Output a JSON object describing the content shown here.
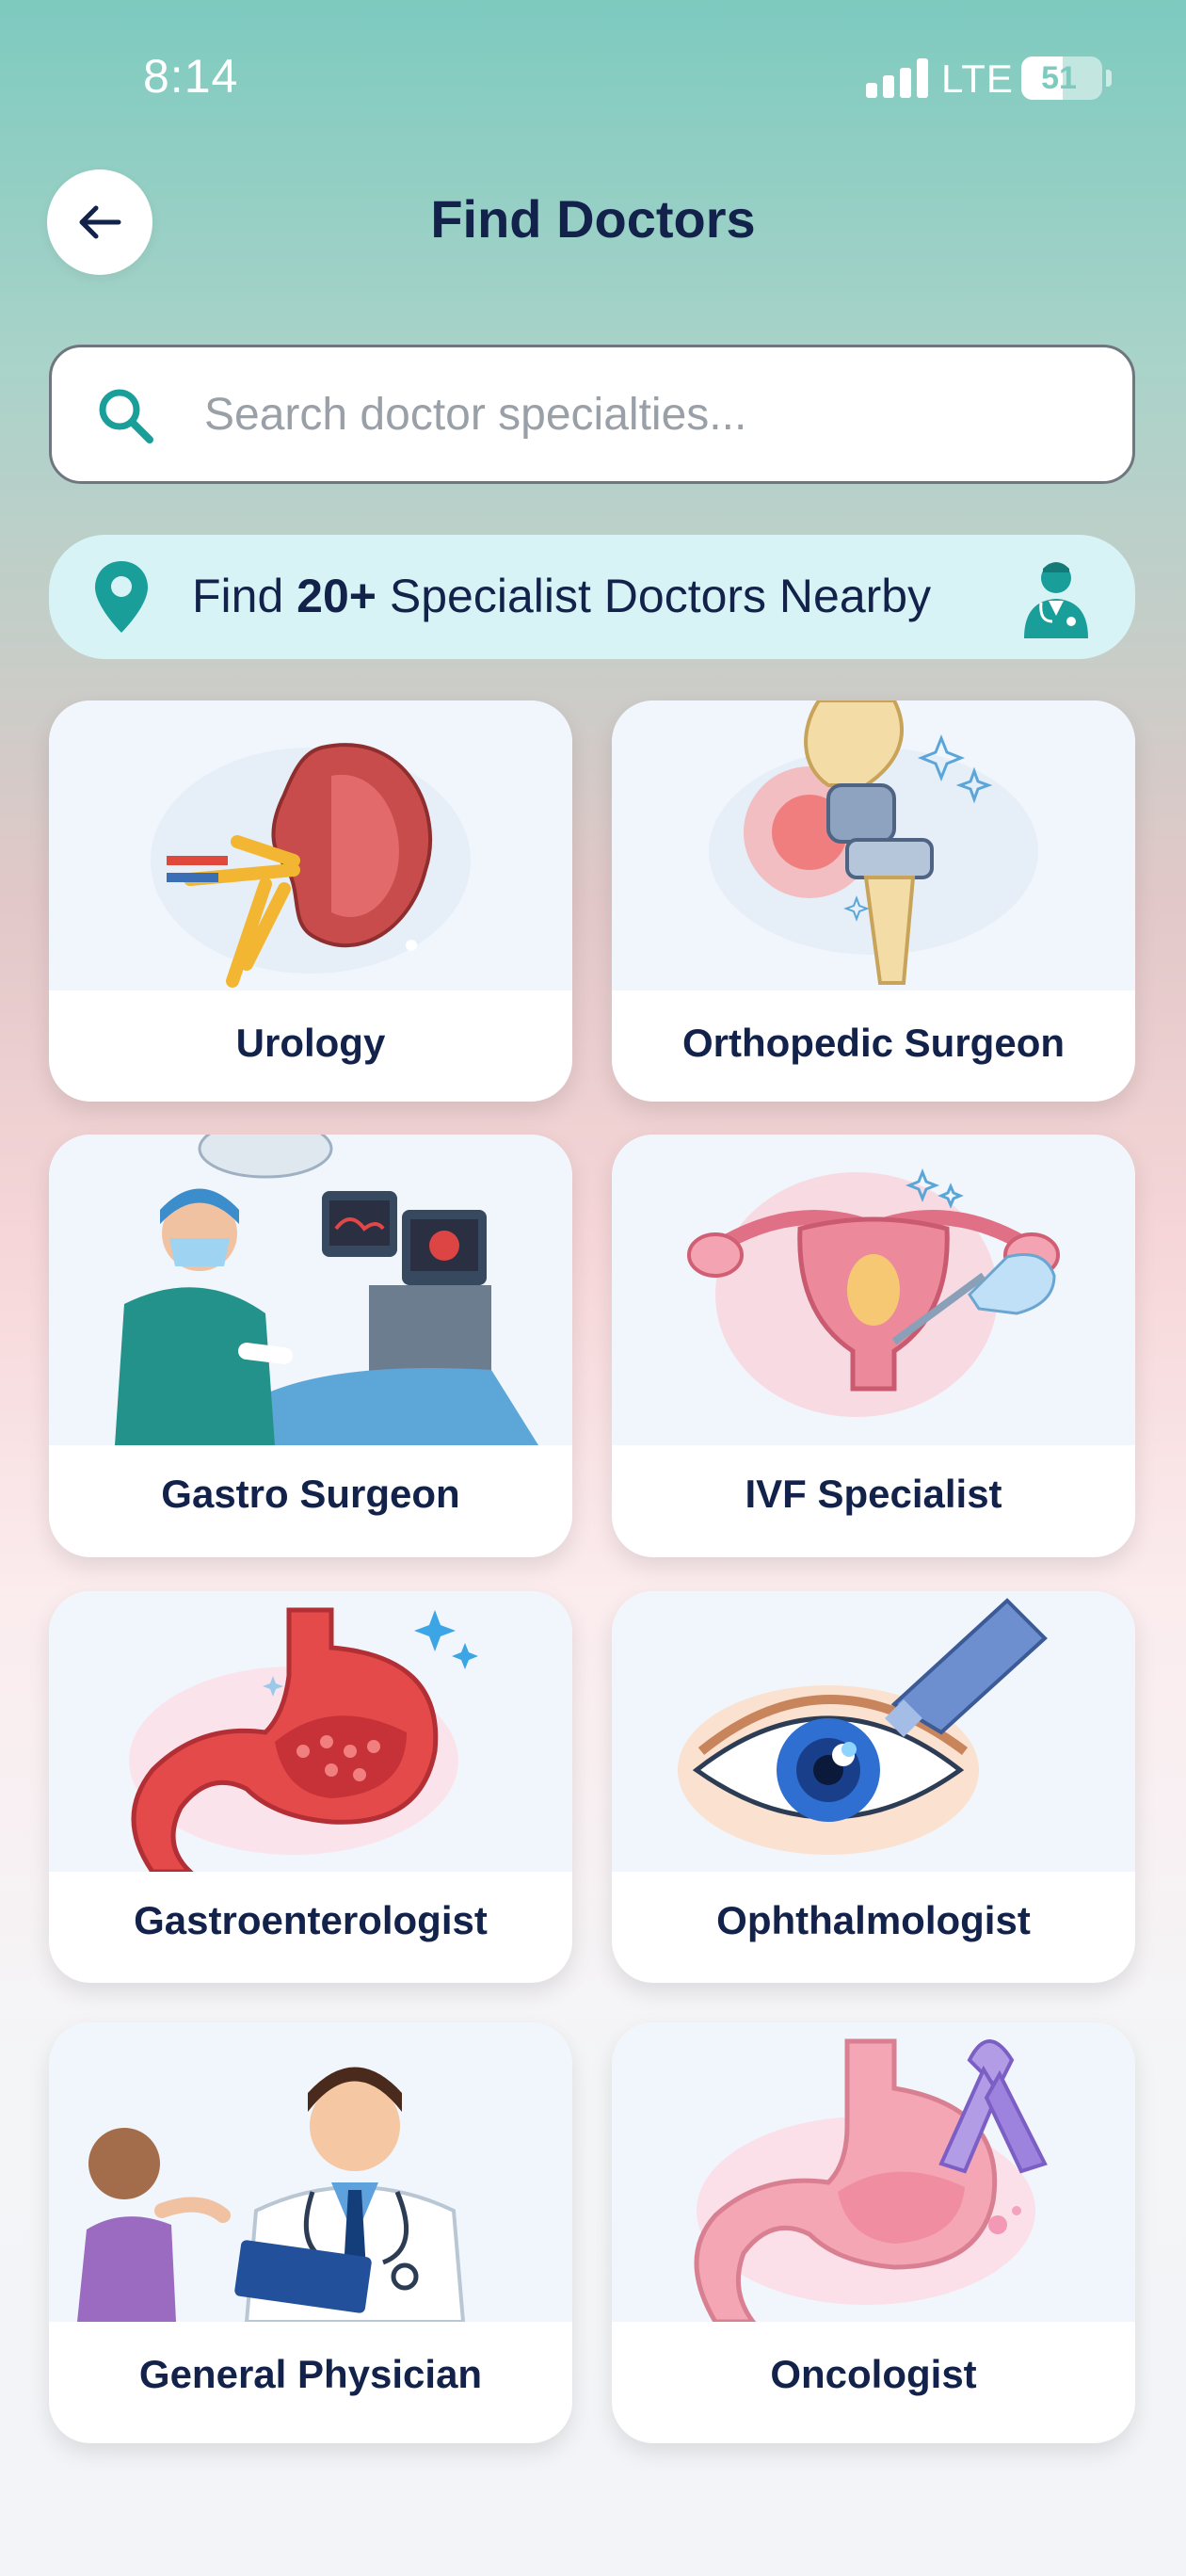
{
  "status_bar": {
    "time": "8:14",
    "network": "LTE",
    "battery": "51",
    "battery_level": 0.51
  },
  "header": {
    "title": "Find Doctors",
    "back_icon": "arrow-left-icon"
  },
  "search": {
    "placeholder": "Search doctor specialties...",
    "value": "",
    "icon": "search-icon"
  },
  "banner": {
    "prefix": "Find ",
    "count": "20+",
    "suffix": " Specialist Doctors Nearby",
    "left_icon": "map-pin-icon",
    "right_icon": "doctor-icon"
  },
  "specialties": [
    {
      "label": "Urology",
      "icon": "kidney-icon"
    },
    {
      "label": "Orthopedic Surgeon",
      "icon": "knee-joint-icon"
    },
    {
      "label": "Gastro Surgeon",
      "icon": "surgeon-operating-icon"
    },
    {
      "label": "IVF Specialist",
      "icon": "uterus-icon"
    },
    {
      "label": "Gastroenterologist",
      "icon": "stomach-icon"
    },
    {
      "label": "Ophthalmologist",
      "icon": "eye-drop-icon"
    },
    {
      "label": "General Physician",
      "icon": "physician-icon"
    },
    {
      "label": "Oncologist",
      "icon": "cancer-ribbon-icon"
    }
  ],
  "colors": {
    "accent": "#1a9e9a",
    "title": "#12224a",
    "banner_bg": "#d8f3f6"
  }
}
